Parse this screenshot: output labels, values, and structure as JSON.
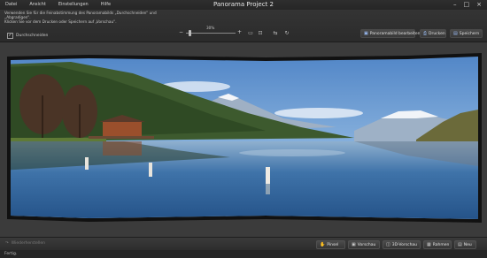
{
  "window": {
    "title": "Panorama Project 2",
    "controls": [
      "–",
      "□",
      "×"
    ]
  },
  "menu": [
    "Datei",
    "Ansicht",
    "Einstellungen",
    "Hilfe"
  ],
  "instructions": [
    "Verwenden Sie für die Feinabstimmung des Panoramabilds „Durchschneiden“ und",
    "„Abgradigen“.",
    "Klicken Sie vor dem Drucken oder Speichern auf „Vorschau“."
  ],
  "toolbar": {
    "zoom_percent": "30%",
    "zoom_level": 0.05,
    "cut_checkbox": {
      "label": "Durchschneiden",
      "checked": true
    },
    "buttons": {
      "edit_panorama": "Panoramabild bearbeiten",
      "print": "Drucken",
      "save": "Speichern"
    }
  },
  "bottom": {
    "redo": "Wiederherstellen",
    "buttons": {
      "brush": "Pinsel",
      "preview": "Vorschau",
      "preview_3d": "3D-Vorschau",
      "frame": "Rahmen",
      "new": "Neu"
    }
  },
  "status": "Fertig.",
  "colors": {
    "accent": "#5b8fd8",
    "toolbar_bg": "#2f2f2f",
    "workspace_bg": "#3b3b3b"
  },
  "icons": {
    "fit": "fit-screen-icon",
    "actual": "actual-size-icon",
    "move": "move-icon",
    "rotate": "rotate-icon"
  }
}
